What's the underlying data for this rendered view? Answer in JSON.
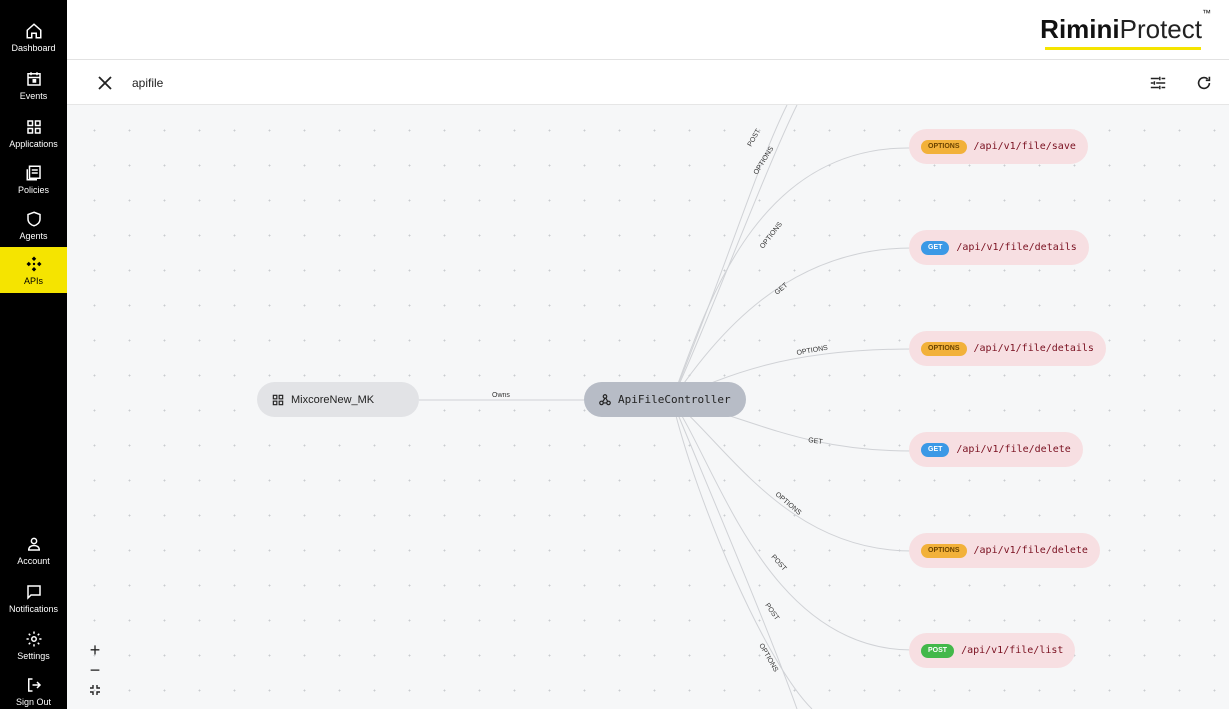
{
  "sidebar": {
    "top_items": [
      {
        "label": "Dashboard",
        "icon": "home-icon"
      },
      {
        "label": "Events",
        "icon": "calendar-icon"
      },
      {
        "label": "Applications",
        "icon": "grid-icon"
      },
      {
        "label": "Policies",
        "icon": "document-icon"
      },
      {
        "label": "Agents",
        "icon": "shield-icon"
      },
      {
        "label": "APIs",
        "icon": "api-icon",
        "active": true
      }
    ],
    "bottom_items": [
      {
        "label": "Account",
        "icon": "user-icon"
      },
      {
        "label": "Notifications",
        "icon": "chat-icon"
      },
      {
        "label": "Settings",
        "icon": "gear-icon"
      },
      {
        "label": "Sign Out",
        "icon": "logout-icon"
      }
    ]
  },
  "header": {
    "logo_bold": "Rimini",
    "logo_light": "Protect",
    "logo_tm": "™",
    "accent_color": "#f5e400"
  },
  "search": {
    "query": "apifile"
  },
  "graph": {
    "application_node": "MixcoreNew_MK",
    "controller_node": "ApiFileController",
    "owns_label": "Owns",
    "edge_labels": [
      "POST",
      "OPTIONS",
      "OPTIONS",
      "GET",
      "OPTIONS",
      "GET",
      "OPTIONS",
      "POST",
      "POST",
      "OPTIONS"
    ],
    "endpoints": [
      {
        "method": "OPTIONS",
        "path": "/api/v1/file/save"
      },
      {
        "method": "GET",
        "path": "/api/v1/file/details"
      },
      {
        "method": "OPTIONS",
        "path": "/api/v1/file/details"
      },
      {
        "method": "GET",
        "path": "/api/v1/file/delete"
      },
      {
        "method": "OPTIONS",
        "path": "/api/v1/file/delete"
      },
      {
        "method": "POST",
        "path": "/api/v1/file/list"
      }
    ],
    "method_colors": {
      "OPTIONS": "#f2b13a",
      "GET": "#3b99e6",
      "POST": "#43b84a"
    }
  },
  "zoom": {
    "in": "+",
    "out": "−",
    "fit": "fit-icon"
  }
}
